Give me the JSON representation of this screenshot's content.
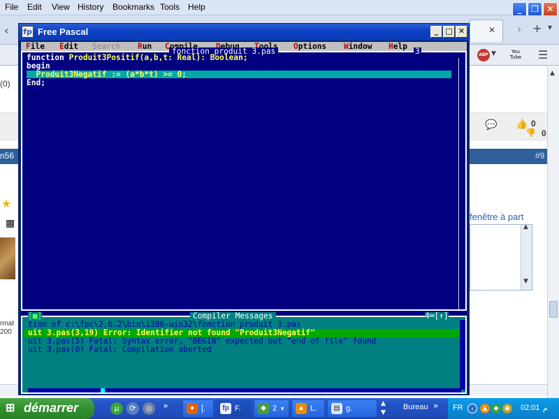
{
  "firefox": {
    "menu": [
      "File",
      "Edit",
      "View",
      "History",
      "Bookmarks",
      "Tools",
      "Help"
    ],
    "tab_close": "✕",
    "side_text": {
      "paren": "(0)",
      "n56": "n56",
      "num9": "#9",
      "counts": [
        "0",
        "0"
      ],
      "popup_link": "fenêtre à part",
      "frag1": "rmat",
      "frag2": "200"
    },
    "abp_badge": "ABP",
    "youtube_label": "You Tube"
  },
  "fpc": {
    "window_title": "Free Pascal",
    "menu": [
      {
        "hotkey": "F",
        "rest": "ile",
        "enabled": true
      },
      {
        "hotkey": "E",
        "rest": "dit",
        "enabled": true
      },
      {
        "hotkey": "S",
        "rest": "earch",
        "enabled": false
      },
      {
        "hotkey": "R",
        "rest": "un",
        "enabled": true
      },
      {
        "hotkey": "C",
        "rest": "ompile",
        "enabled": true
      },
      {
        "hotkey": "D",
        "rest": "ebug",
        "enabled": true
      },
      {
        "hotkey": "T",
        "rest": "ools",
        "enabled": true
      },
      {
        "hotkey": "O",
        "rest": "ptions",
        "enabled": true
      },
      {
        "hotkey": "W",
        "rest": "indow",
        "enabled": true
      },
      {
        "hotkey": "H",
        "rest": "elp",
        "enabled": true
      }
    ],
    "editor": {
      "title": "fonction produit 3.pas",
      "window_number": "3",
      "lines": [
        {
          "kw": "function ",
          "rest": "Produit3Positif(a,b,t: Real): Boolean;"
        },
        {
          "kw": "begin",
          "rest": ""
        },
        {
          "kw": "",
          "rest": "  Produit3Negatif := (a*b*t) >= 0;"
        },
        {
          "kw": "End;",
          "rest": ""
        }
      ]
    },
    "messages": {
      "title": "Compiler Messages",
      "left_marker": "[■]",
      "right_marker": "4═[↑]",
      "lines": [
        "tion of c:\\fpc\\2.6.2\\bin\\i386-win32\\fonction produit 3.pas",
        "uit 3.pas(3,19) Error: Identifier not found \"Produit3Negatif\"",
        "uit 3.pas(5) Fatal: Syntax error, \"BEGIN\" expected but \"end of file\" found",
        "uit 3.pas(0) Fatal: Compilation aborted"
      ],
      "selected_index": 1
    }
  },
  "taskbar": {
    "start_label": "démarrer",
    "buttons": [
      {
        "label": "[.",
        "icon": "firefox-icon"
      },
      {
        "label": "F.",
        "icon": "freepascal-icon"
      },
      {
        "label": "2",
        "icon": "group-icon"
      },
      {
        "label": "L.",
        "icon": "vlc-icon"
      },
      {
        "label": "g.",
        "icon": "notepad-icon"
      }
    ],
    "toolbar_label": "Bureau",
    "language": "FR",
    "clock": "02:01",
    "clock_suffix": "م"
  },
  "colors": {
    "pascal_blue": "#000080",
    "pascal_teal": "#008080",
    "highlight_green": "#00a800",
    "xp_blue": "#2456c7",
    "start_green": "#2f8f2e"
  }
}
